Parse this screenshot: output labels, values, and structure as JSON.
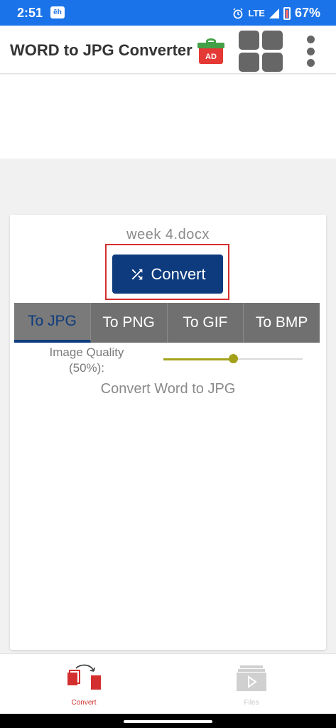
{
  "status_bar": {
    "time": "2:51",
    "notification_badge": "ēh",
    "network": "LTE",
    "battery_percent": "67%"
  },
  "app_bar": {
    "title": "WORD to JPG Converter",
    "ad_label": "AD",
    "icons": [
      "gift-ad-icon",
      "grid-apps-icon",
      "more-vert-icon"
    ]
  },
  "main": {
    "file_name": "week 4.docx",
    "convert_label": "Convert",
    "tabs": [
      {
        "label": "To JPG",
        "active": true
      },
      {
        "label": "To PNG",
        "active": false
      },
      {
        "label": "To GIF",
        "active": false
      },
      {
        "label": "To BMP",
        "active": false
      }
    ],
    "quality_label_line1": "Image Quality",
    "quality_label_line2": "(50%):",
    "quality_value": 0.5,
    "hint": "Convert Word to JPG"
  },
  "bottom_nav": {
    "convert_label": "Convert",
    "files_label": "Files"
  },
  "colors": {
    "status_bar": "#1a73e8",
    "primary": "#0d3b7e",
    "accent_red": "#d32f2f",
    "slider": "#a3a11a",
    "tab_bg": "#707070"
  }
}
